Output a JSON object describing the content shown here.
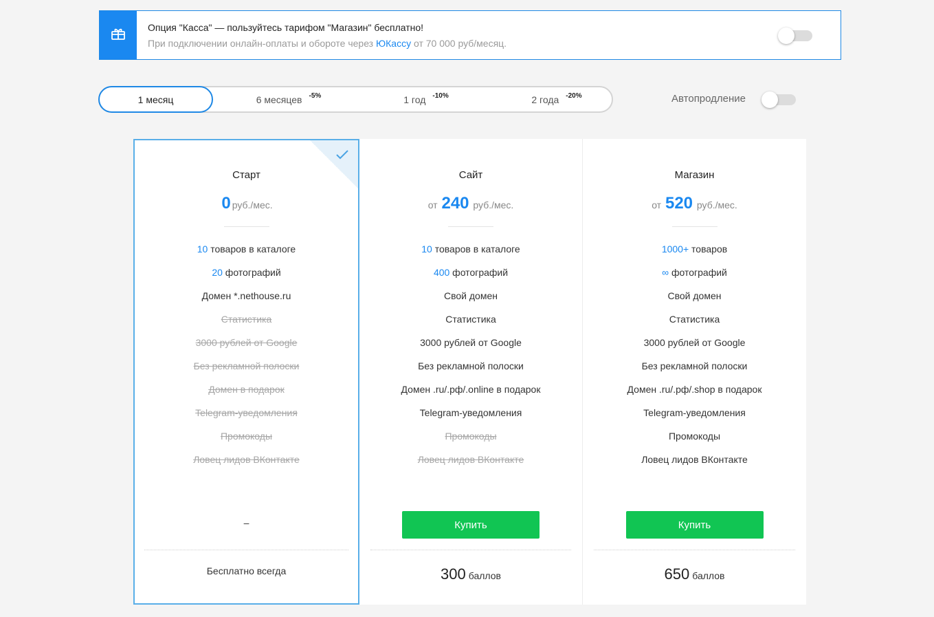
{
  "promo": {
    "icon": "gift-icon",
    "title": "Опция \"Касса\" — пользуйтесь тарифом \"Магазин\" бесплатно!",
    "subtitle_before": "При подключении онлайн-оплаты и обороте через ",
    "subtitle_link": "ЮКассу",
    "subtitle_after": " от 70 000 руб/месяц.",
    "toggle_on": false
  },
  "periods": [
    {
      "label": "1 месяц",
      "discount": "",
      "active": true
    },
    {
      "label": "6 месяцев",
      "discount": "-5%",
      "active": false
    },
    {
      "label": "1 год",
      "discount": "-10%",
      "active": false
    },
    {
      "label": "2 года",
      "discount": "-20%",
      "active": false
    }
  ],
  "autorenew": {
    "label": "Автопродление",
    "on": false
  },
  "colors": {
    "accent": "#1a88f0",
    "buy": "#11c553",
    "selected_border": "#58aee8"
  },
  "plans": [
    {
      "name": "Старт",
      "price_prefix": "",
      "price": "0",
      "price_unit": "руб./мес.",
      "selected": true,
      "features": [
        {
          "hl": "10",
          "text": " товаров в каталоге",
          "off": false
        },
        {
          "hl": "20",
          "text": " фотографий",
          "off": false
        },
        {
          "hl": "",
          "text": "Домен *.nethouse.ru",
          "off": false
        },
        {
          "hl": "",
          "text": "Статистика",
          "off": true
        },
        {
          "hl": "",
          "text": "3000 рублей от Google",
          "off": true
        },
        {
          "hl": "",
          "text": "Без рекламной полоски",
          "off": true
        },
        {
          "hl": "",
          "text": "Домен в подарок",
          "off": true
        },
        {
          "hl": "",
          "text": "Telegram-уведомления",
          "off": true
        },
        {
          "hl": "",
          "text": "Промокоды",
          "off": true
        },
        {
          "hl": "",
          "text": "Ловец лидов ВКонтакте",
          "off": true
        }
      ],
      "action": "–",
      "bottom_num": "",
      "bottom_text": "Бесплатно всегда"
    },
    {
      "name": "Сайт",
      "price_prefix": "от",
      "price": "240",
      "price_unit": "руб./мес.",
      "selected": false,
      "features": [
        {
          "hl": "10",
          "text": " товаров в каталоге",
          "off": false
        },
        {
          "hl": "400",
          "text": " фотографий",
          "off": false
        },
        {
          "hl": "",
          "text": "Свой домен",
          "off": false
        },
        {
          "hl": "",
          "text": "Статистика",
          "off": false
        },
        {
          "hl": "",
          "text": "3000 рублей от Google",
          "off": false
        },
        {
          "hl": "",
          "text": "Без рекламной полоски",
          "off": false
        },
        {
          "hl": "",
          "text": "Домен .ru/.рф/.online в подарок",
          "off": false
        },
        {
          "hl": "",
          "text": "Telegram-уведомления",
          "off": false
        },
        {
          "hl": "",
          "text": "Промокоды",
          "off": true
        },
        {
          "hl": "",
          "text": "Ловец лидов ВКонтакте",
          "off": true
        }
      ],
      "action": "Купить",
      "bottom_num": "300",
      "bottom_text": "баллов"
    },
    {
      "name": "Магазин",
      "price_prefix": "от",
      "price": "520",
      "price_unit": "руб./мес.",
      "selected": false,
      "features": [
        {
          "hl": "1000+",
          "text": " товаров",
          "off": false
        },
        {
          "hl": "∞",
          "text": " фотографий",
          "off": false
        },
        {
          "hl": "",
          "text": "Свой домен",
          "off": false
        },
        {
          "hl": "",
          "text": "Статистика",
          "off": false
        },
        {
          "hl": "",
          "text": "3000 рублей от Google",
          "off": false
        },
        {
          "hl": "",
          "text": "Без рекламной полоски",
          "off": false
        },
        {
          "hl": "",
          "text": "Домен .ru/.рф/.shop в подарок",
          "off": false
        },
        {
          "hl": "",
          "text": "Telegram-уведомления",
          "off": false
        },
        {
          "hl": "",
          "text": "Промокоды",
          "off": false
        },
        {
          "hl": "",
          "text": "Ловец лидов ВКонтакте",
          "off": false
        }
      ],
      "action": "Купить",
      "bottom_num": "650",
      "bottom_text": "баллов"
    }
  ]
}
